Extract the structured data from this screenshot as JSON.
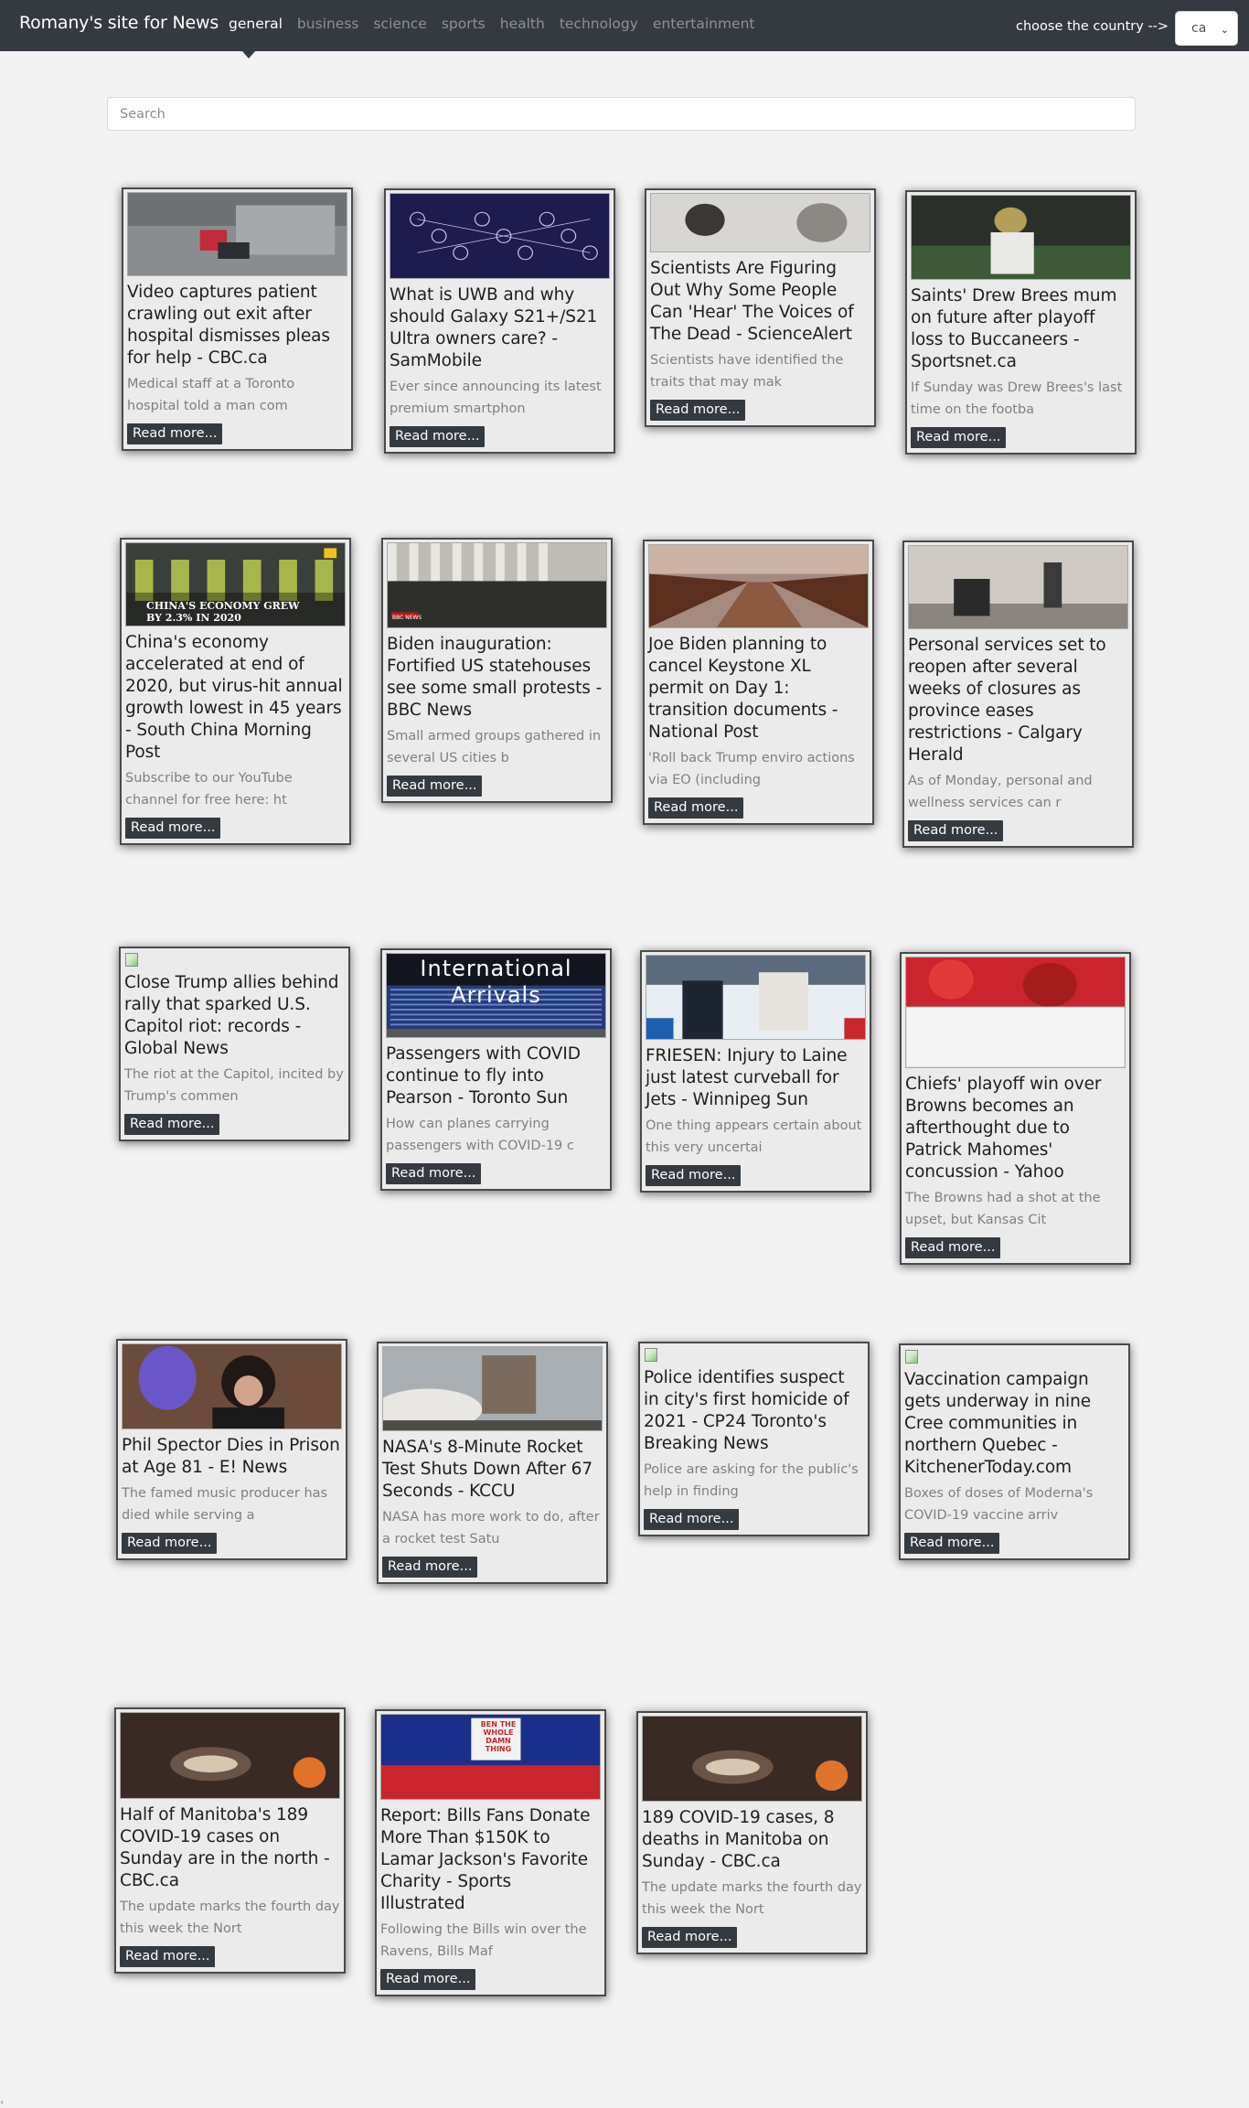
{
  "nav": {
    "brand": "Romany's site for News",
    "links": [
      "general",
      "business",
      "science",
      "sports",
      "health",
      "technology",
      "entertainment"
    ],
    "active_index": 0,
    "country_label": "choose the country -->",
    "country_value": "ca",
    "country_chevron": "⌄"
  },
  "search": {
    "placeholder": "Search"
  },
  "read_more": "Read more...",
  "colors": {
    "navbar": "#343a40",
    "button": "#343a40",
    "card": "#ebebeb",
    "page": "#f3f3f4"
  },
  "cards": [
    {
      "title": "Video captures patient crawling out exit after hospital dismisses pleas for help - CBC.ca",
      "desc": "Medical staff at a Toronto hospital told a man com",
      "image": "hospital-hallway-photo"
    },
    {
      "title": "What is UWB and why should Galaxy S21+/S21 Ultra owners care? - SamMobile",
      "desc": "Ever since announcing its latest premium smartphon",
      "image": "connected-devices-illustration"
    },
    {
      "title": "Scientists Are Figuring Out Why Some People Can 'Hear' The Voices of The Dead - ScienceAlert",
      "desc": "Scientists have identified the traits that may mak",
      "image": "vintage-portrait-photo"
    },
    {
      "title": "Saints' Drew Brees mum on future after playoff loss to Buccaneers - Sportsnet.ca",
      "desc": "If Sunday was Drew Brees's last time on the footba",
      "image": "football-quarterback-photo"
    },
    {
      "title": "China's economy accelerated at end of 2020, but virus-hit annual growth lowest in 45 years - South China Morning Post",
      "desc": "Subscribe to our YouTube channel for free here: ht",
      "image": "factory-robots-photo",
      "overlay": "CHINA'S ECONOMY GREW BY 2.3% IN 2020"
    },
    {
      "title": "Biden inauguration: Fortified US statehouses see some small protests - BBC News",
      "desc": "Small armed groups gathered in several US cities b",
      "image": "protest-crowd-photo",
      "badge": "BBC NEWS"
    },
    {
      "title": "Joe Biden planning to cancel Keystone XL permit on Day 1: transition documents - National Post",
      "desc": "'Roll back Trump enviro actions via EO (including",
      "image": "pipeline-stacks-photo"
    },
    {
      "title": "Personal services set to reopen after several weeks of closures as province eases restrictions - Calgary Herald",
      "desc": "As of Monday, personal and wellness services can r",
      "image": "barber-shop-photo"
    },
    {
      "title": "Close Trump allies behind rally that sparked U.S. Capitol riot: records - Global News",
      "desc": "The riot at the Capitol, incited by Trump's commen",
      "image": "broken-image"
    },
    {
      "title": "Passengers with COVID continue to fly into Pearson - Toronto Sun",
      "desc": "How can planes carrying passengers with COVID-19 c",
      "image": "arrivals-board-photo",
      "overlay": "International Arrivals"
    },
    {
      "title": "FRIESEN: Injury to Laine just latest curveball for Jets - Winnipeg Sun",
      "desc": "One thing appears certain about this very uncertai",
      "image": "hockey-rink-photo"
    },
    {
      "title": "Chiefs' playoff win over Browns becomes an afterthought due to Patrick Mahomes' concussion - Yahoo",
      "desc": "The Browns had a shot at the upset, but Kansas Cit",
      "image": "chiefs-players-photo"
    },
    {
      "title": "Phil Spector Dies in Prison at Age 81 - E! News",
      "desc": "The famed music producer has died while serving a",
      "image": "courtroom-portrait-photo"
    },
    {
      "title": "NASA's 8-Minute Rocket Test Shuts Down After 67 Seconds - KCCU",
      "desc": "NASA has more work to do, after a rocket test Satu",
      "image": "rocket-test-stand-photo"
    },
    {
      "title": "Police identifies suspect in city's first homicide of 2021 - CP24 Toronto's Breaking News",
      "desc": "Police are asking for the public's help in finding",
      "image": "broken-image"
    },
    {
      "title": "Vaccination campaign gets underway in nine Cree communities in northern Quebec - KitchenerToday.com",
      "desc": "Boxes of doses of Moderna's COVID-19 vaccine arriv",
      "image": "broken-image"
    },
    {
      "title": "Half of Manitoba's 189 COVID-19 cases on Sunday are in the north - CBC.ca",
      "desc": "The update marks the fourth day this week the Nort",
      "image": "lab-glasses-photo"
    },
    {
      "title": "Report: Bills Fans Donate More Than $150K to Lamar Jackson's Favorite Charity - Sports Illustrated",
      "desc": "Following the Bills win over the Ravens, Bills Maf",
      "image": "bills-fans-photo",
      "overlay": "BEN THE WHOLE DAMN THING"
    },
    {
      "title": "189 COVID-19 cases, 8 deaths in Manitoba on Sunday - CBC.ca",
      "desc": "The update marks the fourth day this week the Nort",
      "image": "lab-glasses-photo"
    }
  ],
  "footer_mark": "‹"
}
